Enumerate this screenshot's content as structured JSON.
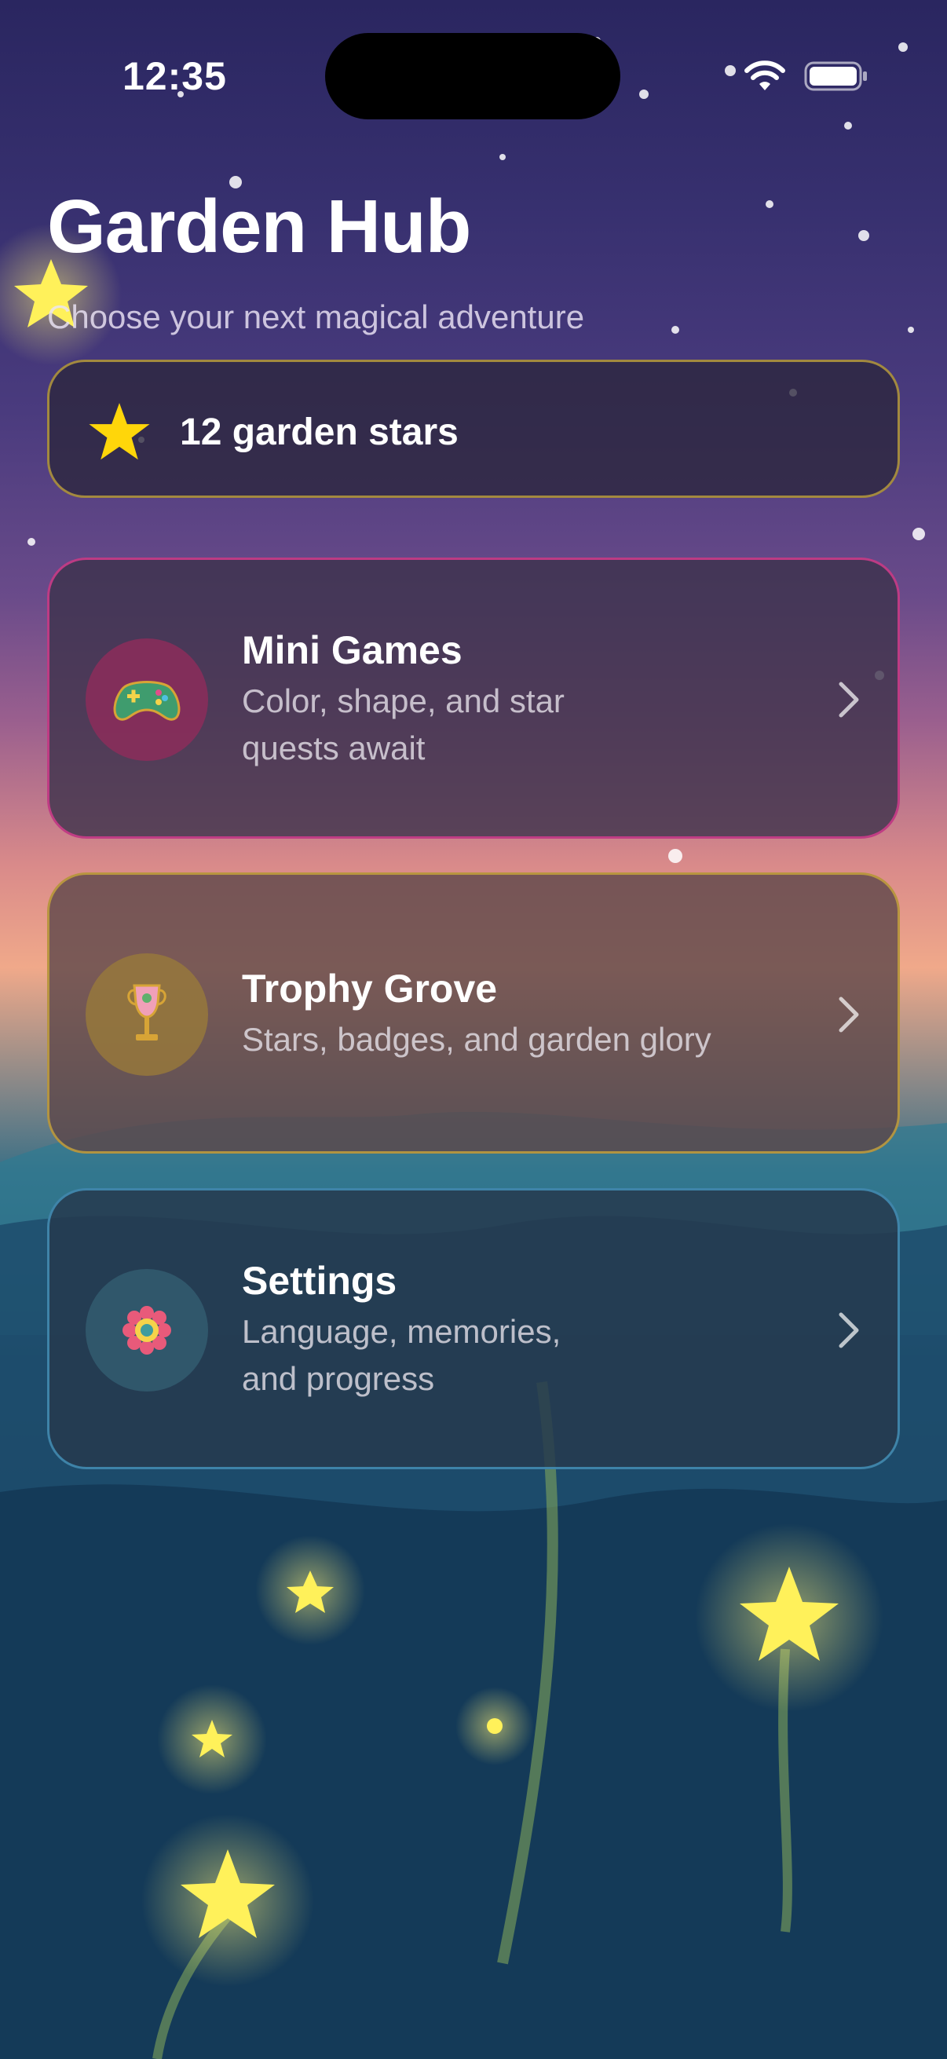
{
  "status_bar": {
    "time": "12:35"
  },
  "header": {
    "title": "Garden Hub",
    "subtitle": "Choose your next magical adventure"
  },
  "stars_summary": {
    "label": "12 garden stars",
    "icon": "star-icon"
  },
  "menu": {
    "items": [
      {
        "title": "Mini Games",
        "description_line1": "Color, shape, and star",
        "description_line2": "quests await",
        "icon": "game-controller-icon",
        "accent": "#d23c8c"
      },
      {
        "title": "Trophy Grove",
        "description_line1": "Stars, badges, and garden glory",
        "icon": "trophy-icon",
        "accent": "#c8a53c"
      },
      {
        "title": "Settings",
        "description_line1": "Language, memories,",
        "description_line2": "and progress",
        "icon": "flower-gear-icon",
        "accent": "#4696be"
      }
    ]
  },
  "colors": {
    "star_yellow": "#ffd700",
    "text": "#ffffff"
  }
}
